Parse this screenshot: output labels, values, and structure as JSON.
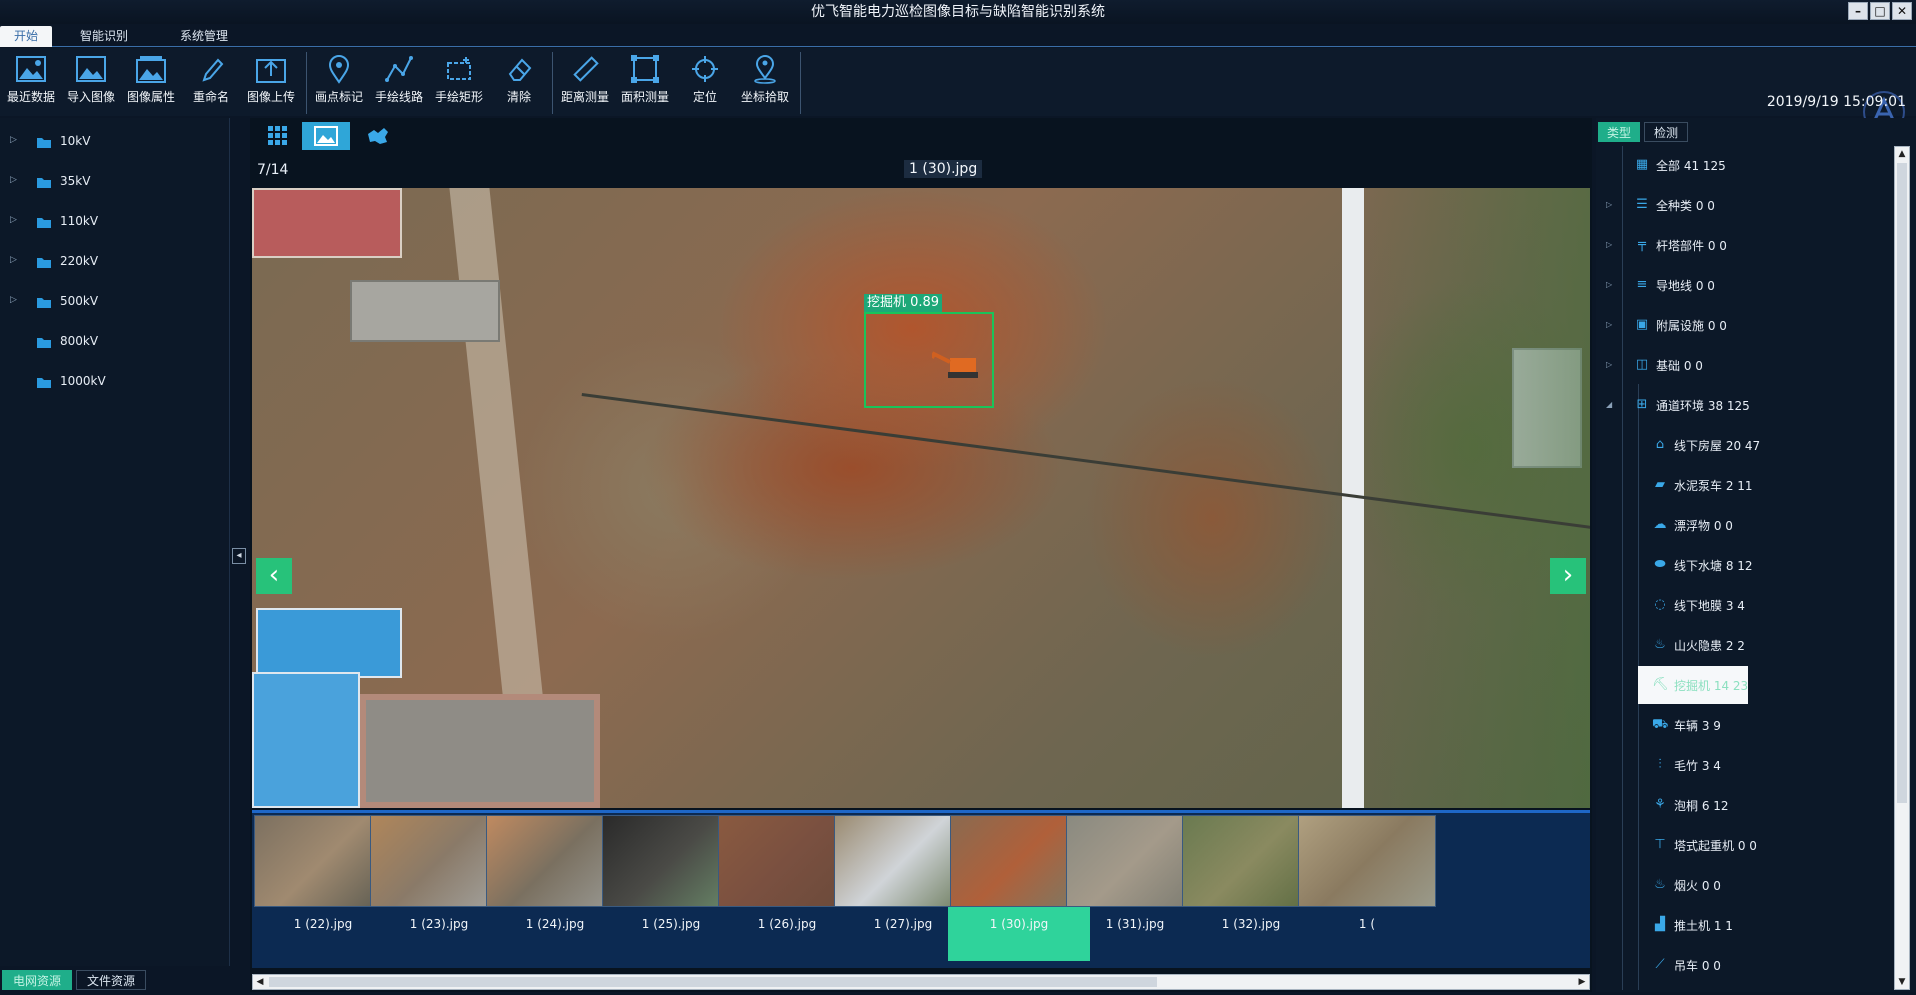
{
  "window": {
    "title": "优飞智能电力巡检图像目标与缺陷智能识别系统"
  },
  "menu": [
    "开始",
    "智能识别",
    "系统管理"
  ],
  "toolbar": {
    "groups": [
      [
        "最近数据",
        "导入图像",
        "图像属性",
        "重命名",
        "图像上传"
      ],
      [
        "画点标记",
        "手绘线路",
        "手绘矩形",
        "清除"
      ],
      [
        "距离测量",
        "面积测量",
        "定位",
        "坐标拾取"
      ]
    ]
  },
  "datetime": "2019/9/19 15:09:01",
  "left_tree": [
    "10kV",
    "35kV",
    "110kV",
    "220kV",
    "500kV",
    "800kV",
    "1000kV"
  ],
  "left_tabs": [
    "电网资源",
    "文件资源"
  ],
  "viewer": {
    "counter": "7/14",
    "filename": "1 (30).jpg",
    "detection_label": "挖掘机 0.89"
  },
  "thumbnails": [
    "1 (22).jpg",
    "1 (23).jpg",
    "1 (24).jpg",
    "1 (25).jpg",
    "1 (26).jpg",
    "1 (27).jpg",
    "1 (30).jpg",
    "1 (31).jpg",
    "1 (32).jpg",
    "1 ("
  ],
  "right_tabs": [
    "类型",
    "检测"
  ],
  "categories": [
    {
      "label": "全部 41 125",
      "level": 0,
      "icon": "grid-icon"
    },
    {
      "label": "全种类 0 0",
      "level": 1,
      "icon": "list-icon"
    },
    {
      "label": "杆塔部件 0 0",
      "level": 1,
      "icon": "tower-icon"
    },
    {
      "label": "导地线 0 0",
      "level": 1,
      "icon": "wire-icon"
    },
    {
      "label": "附属设施 0 0",
      "level": 1,
      "icon": "facility-icon"
    },
    {
      "label": "基础 0 0",
      "level": 1,
      "icon": "foundation-icon"
    },
    {
      "label": "通道环境 38 125",
      "level": 1,
      "icon": "channel-icon"
    },
    {
      "label": "线下房屋 20 47",
      "level": 2,
      "icon": "house-icon"
    },
    {
      "label": "水泥泵车 2 11",
      "level": 2,
      "icon": "pump-truck-icon"
    },
    {
      "label": "漂浮物 0 0",
      "level": 2,
      "icon": "floating-icon"
    },
    {
      "label": "线下水塘 8 12",
      "level": 2,
      "icon": "pond-icon"
    },
    {
      "label": "线下地膜 3 4",
      "level": 2,
      "icon": "film-icon"
    },
    {
      "label": "山火隐患 2 2",
      "level": 2,
      "icon": "fire-icon"
    },
    {
      "label": "挖掘机 14 23",
      "level": 2,
      "icon": "excavator-icon",
      "selected": true
    },
    {
      "label": "车辆 3 9",
      "level": 2,
      "icon": "vehicle-icon"
    },
    {
      "label": "毛竹 3 4",
      "level": 2,
      "icon": "bamboo-icon"
    },
    {
      "label": "泡桐 6 12",
      "level": 2,
      "icon": "tree-icon"
    },
    {
      "label": "塔式起重机 0 0",
      "level": 2,
      "icon": "crane-icon"
    },
    {
      "label": "烟火 0 0",
      "level": 2,
      "icon": "smoke-icon"
    },
    {
      "label": "推土机 1 1",
      "level": 2,
      "icon": "bulldozer-icon"
    },
    {
      "label": "吊车 0 0",
      "level": 2,
      "icon": "truck-crane-icon"
    }
  ],
  "colors": {
    "accent": "#2fa6d8",
    "selected": "#2fd39b",
    "detection_box": "#19c45a"
  }
}
